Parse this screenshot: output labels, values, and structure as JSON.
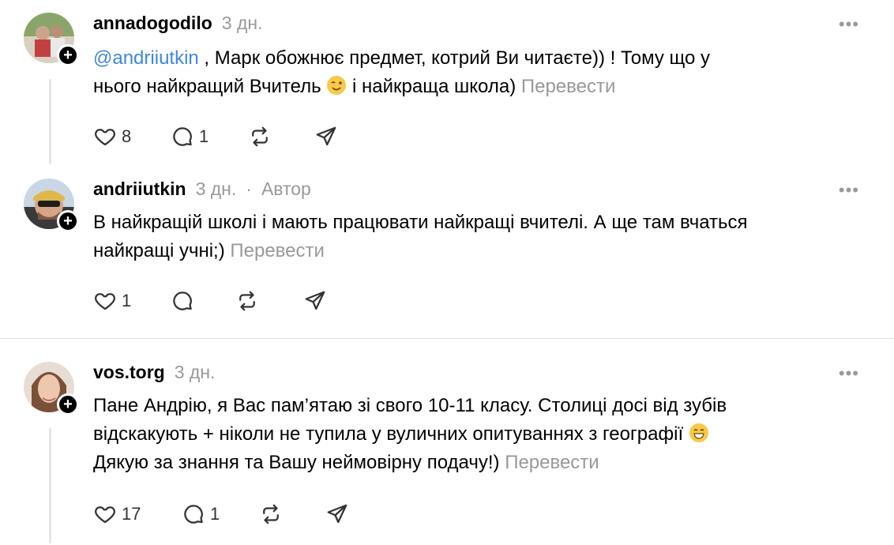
{
  "posts": [
    {
      "username": "annadogodilo",
      "time": "3 дн.",
      "mention": "@andriiutkin",
      "text_line1_rest": " , Марк обожнює предмет, котрий Ви читаєте)) ! Тому що у",
      "text_line2_a": "нього найкращий Вчитель ",
      "text_line2_b": " і найкраща школа) ",
      "translate": "Перевести",
      "likes": "8",
      "replies": "1"
    },
    {
      "username": "andriiutkin",
      "time": "3 дн.",
      "separator": "·",
      "author_label": "Автор",
      "text_line1": "В найкращій школі і мають працювати найкращі вчителі. А ще там вчаться",
      "text_line2": "найкращі учні;) ",
      "translate": "Перевести",
      "likes": "1"
    },
    {
      "username": "vos.torg",
      "time": "3 дн.",
      "text_line1": "Пане Андрію, я Вас пам’ятаю зі свого 10-11 класу. Столиці досі від зубів",
      "text_line2": "відскакують + ніколи не тупила у вуличних опитуваннях з географії ",
      "text_line3": "Дякую за знання та Вашу неймовірну подачу!) ",
      "translate": "Перевести",
      "likes": "17",
      "replies": "1"
    }
  ],
  "icons": {
    "more": "more-icon",
    "like": "heart-icon",
    "reply": "comment-icon",
    "repost": "repost-icon",
    "share": "share-icon",
    "follow": "plus-icon"
  },
  "colors": {
    "mention": "#3f87e0",
    "muted": "#999999",
    "text": "#000000"
  }
}
